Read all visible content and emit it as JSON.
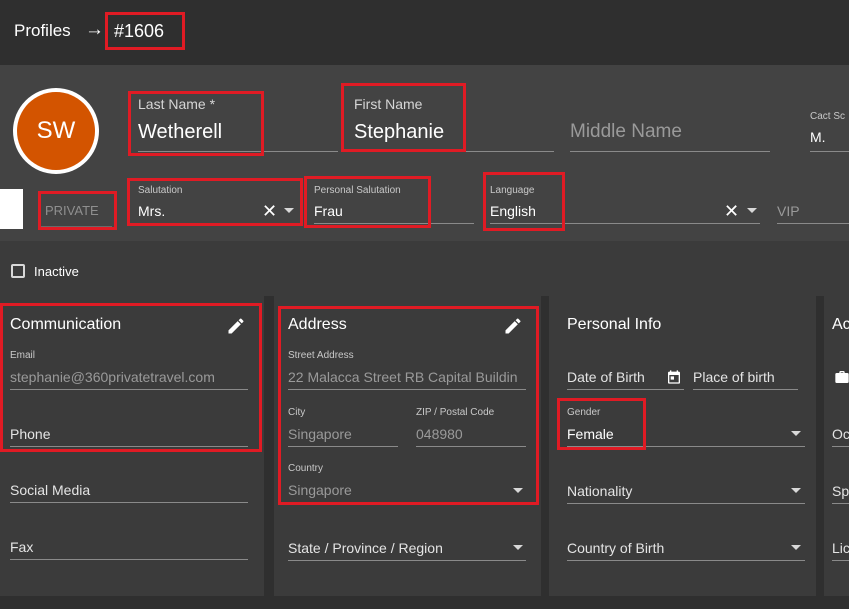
{
  "breadcrumb": {
    "root": "Profiles",
    "arrow": "→",
    "current": "#1606"
  },
  "avatar": {
    "initials": "SW",
    "color": "#d35400"
  },
  "header": {
    "last_name": {
      "label": "Last Name *",
      "value": "Wetherell"
    },
    "first_name": {
      "label": "First Name",
      "value": "Stephanie"
    },
    "middle_name": {
      "placeholder": "Middle Name"
    },
    "contact_short": {
      "label": "Cact Sc",
      "value": "M."
    },
    "private_badge": "PRIVATE",
    "salutation": {
      "label": "Salutation",
      "value": "Mrs."
    },
    "personal_salutation": {
      "label": "Personal Salutation",
      "value": "Frau"
    },
    "language": {
      "label": "Language",
      "value": "English"
    },
    "vip": {
      "placeholder": "VIP"
    }
  },
  "inactive": {
    "label": "Inactive",
    "checked": false
  },
  "communication": {
    "title": "Communication",
    "email": {
      "label": "Email",
      "value": "stephanie@360privatetravel.com"
    },
    "phone": {
      "placeholder": "Phone"
    },
    "social": {
      "placeholder": "Social Media"
    },
    "fax": {
      "placeholder": "Fax"
    }
  },
  "address": {
    "title": "Address",
    "street": {
      "label": "Street Address",
      "value": "22 Malacca Street RB Capital Buildin"
    },
    "city": {
      "label": "City",
      "value": "Singapore"
    },
    "zip": {
      "label": "ZIP / Postal Code",
      "value": "048980"
    },
    "country": {
      "label": "Country",
      "value": "Singapore"
    },
    "state": {
      "placeholder": "State / Province / Region"
    }
  },
  "personal": {
    "title": "Personal Info",
    "dob": {
      "placeholder": "Date of Birth"
    },
    "pob": {
      "placeholder": "Place of birth"
    },
    "gender": {
      "label": "Gender",
      "value": "Female"
    },
    "nationality": {
      "placeholder": "Nationality"
    },
    "country_birth": {
      "placeholder": "Country of Birth"
    }
  },
  "fourth_card": {
    "title": "Ac",
    "r1": "Oc",
    "r2": "Sp",
    "r3": "Lic"
  },
  "colors": {
    "highlight": "#e01b24",
    "topbar": "#2f2f2f",
    "header": "#434343",
    "card": "#3a3a3a"
  }
}
